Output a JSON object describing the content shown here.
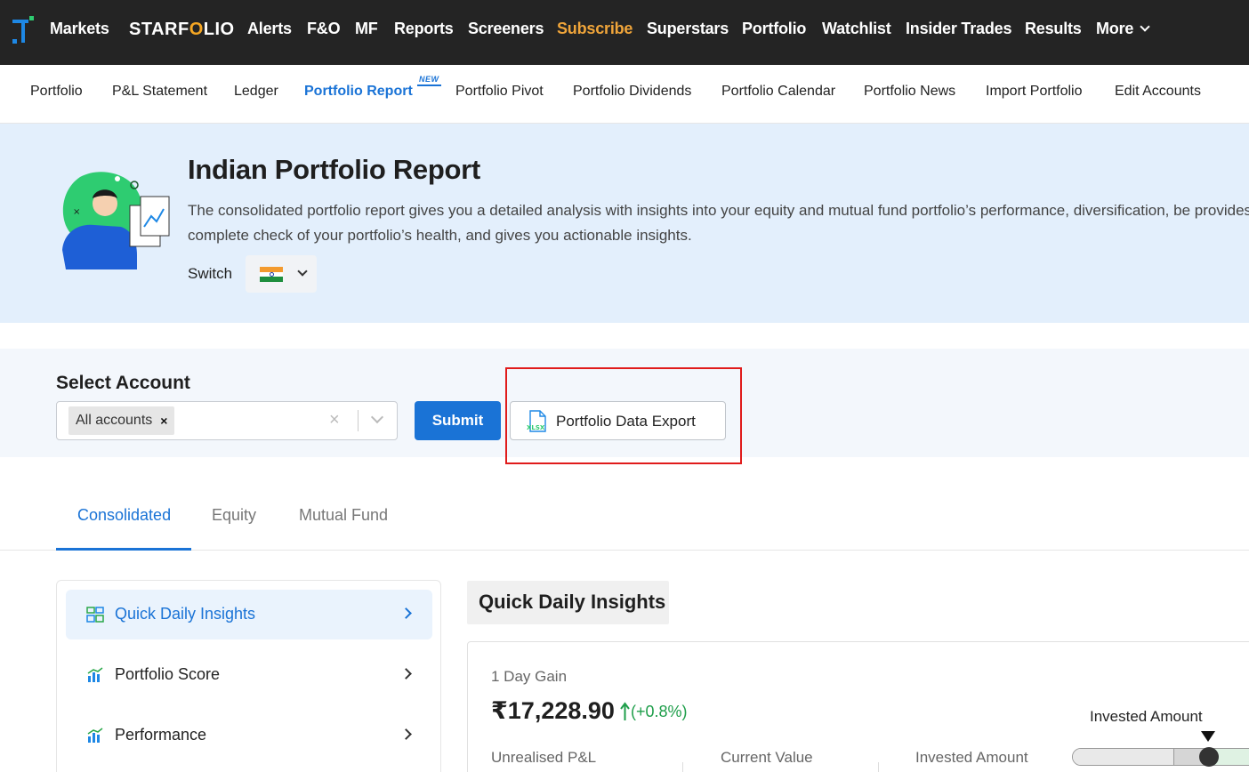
{
  "topnav": {
    "items": [
      {
        "label": "Markets"
      },
      {
        "label": "Alerts"
      },
      {
        "label": "F&O"
      },
      {
        "label": "MF"
      },
      {
        "label": "Reports"
      },
      {
        "label": "Screeners"
      },
      {
        "label": "Subscribe"
      },
      {
        "label": "Superstars"
      },
      {
        "label": "Portfolio"
      },
      {
        "label": "Watchlist"
      },
      {
        "label": "Insider Trades"
      },
      {
        "label": "Results"
      },
      {
        "label": "More"
      }
    ],
    "brand_left": "STARF",
    "brand_o": "O",
    "brand_right": "LIO",
    "subscribe_color": "#f0a53a"
  },
  "subnav": {
    "items": [
      {
        "label": "Portfolio"
      },
      {
        "label": "P&L Statement"
      },
      {
        "label": "Ledger"
      },
      {
        "label": "Portfolio Report"
      },
      {
        "label": "Portfolio Pivot"
      },
      {
        "label": "Portfolio Dividends"
      },
      {
        "label": "Portfolio Calendar"
      },
      {
        "label": "Portfolio News"
      },
      {
        "label": "Import Portfolio"
      },
      {
        "label": "Edit Accounts"
      }
    ],
    "active": "Portfolio Report",
    "new_badge": "NEW"
  },
  "hero": {
    "title": "Indian Portfolio Report",
    "description": "The consolidated portfolio report gives you a detailed analysis with insights into your equity and mutual fund portfolio’s performance, diversification, be provides a complete check of your portfolio’s health, and gives you actionable insights.",
    "switch_label": "Switch",
    "switch_flag": "india-flag-icon"
  },
  "account": {
    "label": "Select Account",
    "selected_chip": "All accounts",
    "chip_remove": "×",
    "clear": "×",
    "submit": "Submit",
    "export_label": "Portfolio Data Export",
    "export_icon": "xlsx-file-icon",
    "export_icon_text": "XLSX"
  },
  "tabs": [
    {
      "label": "Consolidated"
    },
    {
      "label": "Equity"
    },
    {
      "label": "Mutual Fund"
    }
  ],
  "sidebar": {
    "items": [
      {
        "label": "Quick Daily Insights",
        "icon": "insights-icon"
      },
      {
        "label": "Portfolio Score",
        "icon": "bar-chart-icon"
      },
      {
        "label": "Performance",
        "icon": "bar-chart-icon"
      }
    ]
  },
  "panel": {
    "title": "Quick Daily Insights",
    "gain_label": "1 Day Gain",
    "gain_value": "₹17,228.90",
    "gain_pct": "(+0.8%)",
    "gain_color": "#1e9e4a",
    "metrics": [
      {
        "label": "Unrealised P&L"
      },
      {
        "label": "Current Value"
      },
      {
        "label": "Invested Amount"
      }
    ],
    "range_marker_label": "Invested Amount"
  },
  "colors": {
    "accent": "#1a73d6",
    "nav_bg": "#242424",
    "hero_bg": "#e3effc",
    "highlight": "#e01b1b"
  }
}
